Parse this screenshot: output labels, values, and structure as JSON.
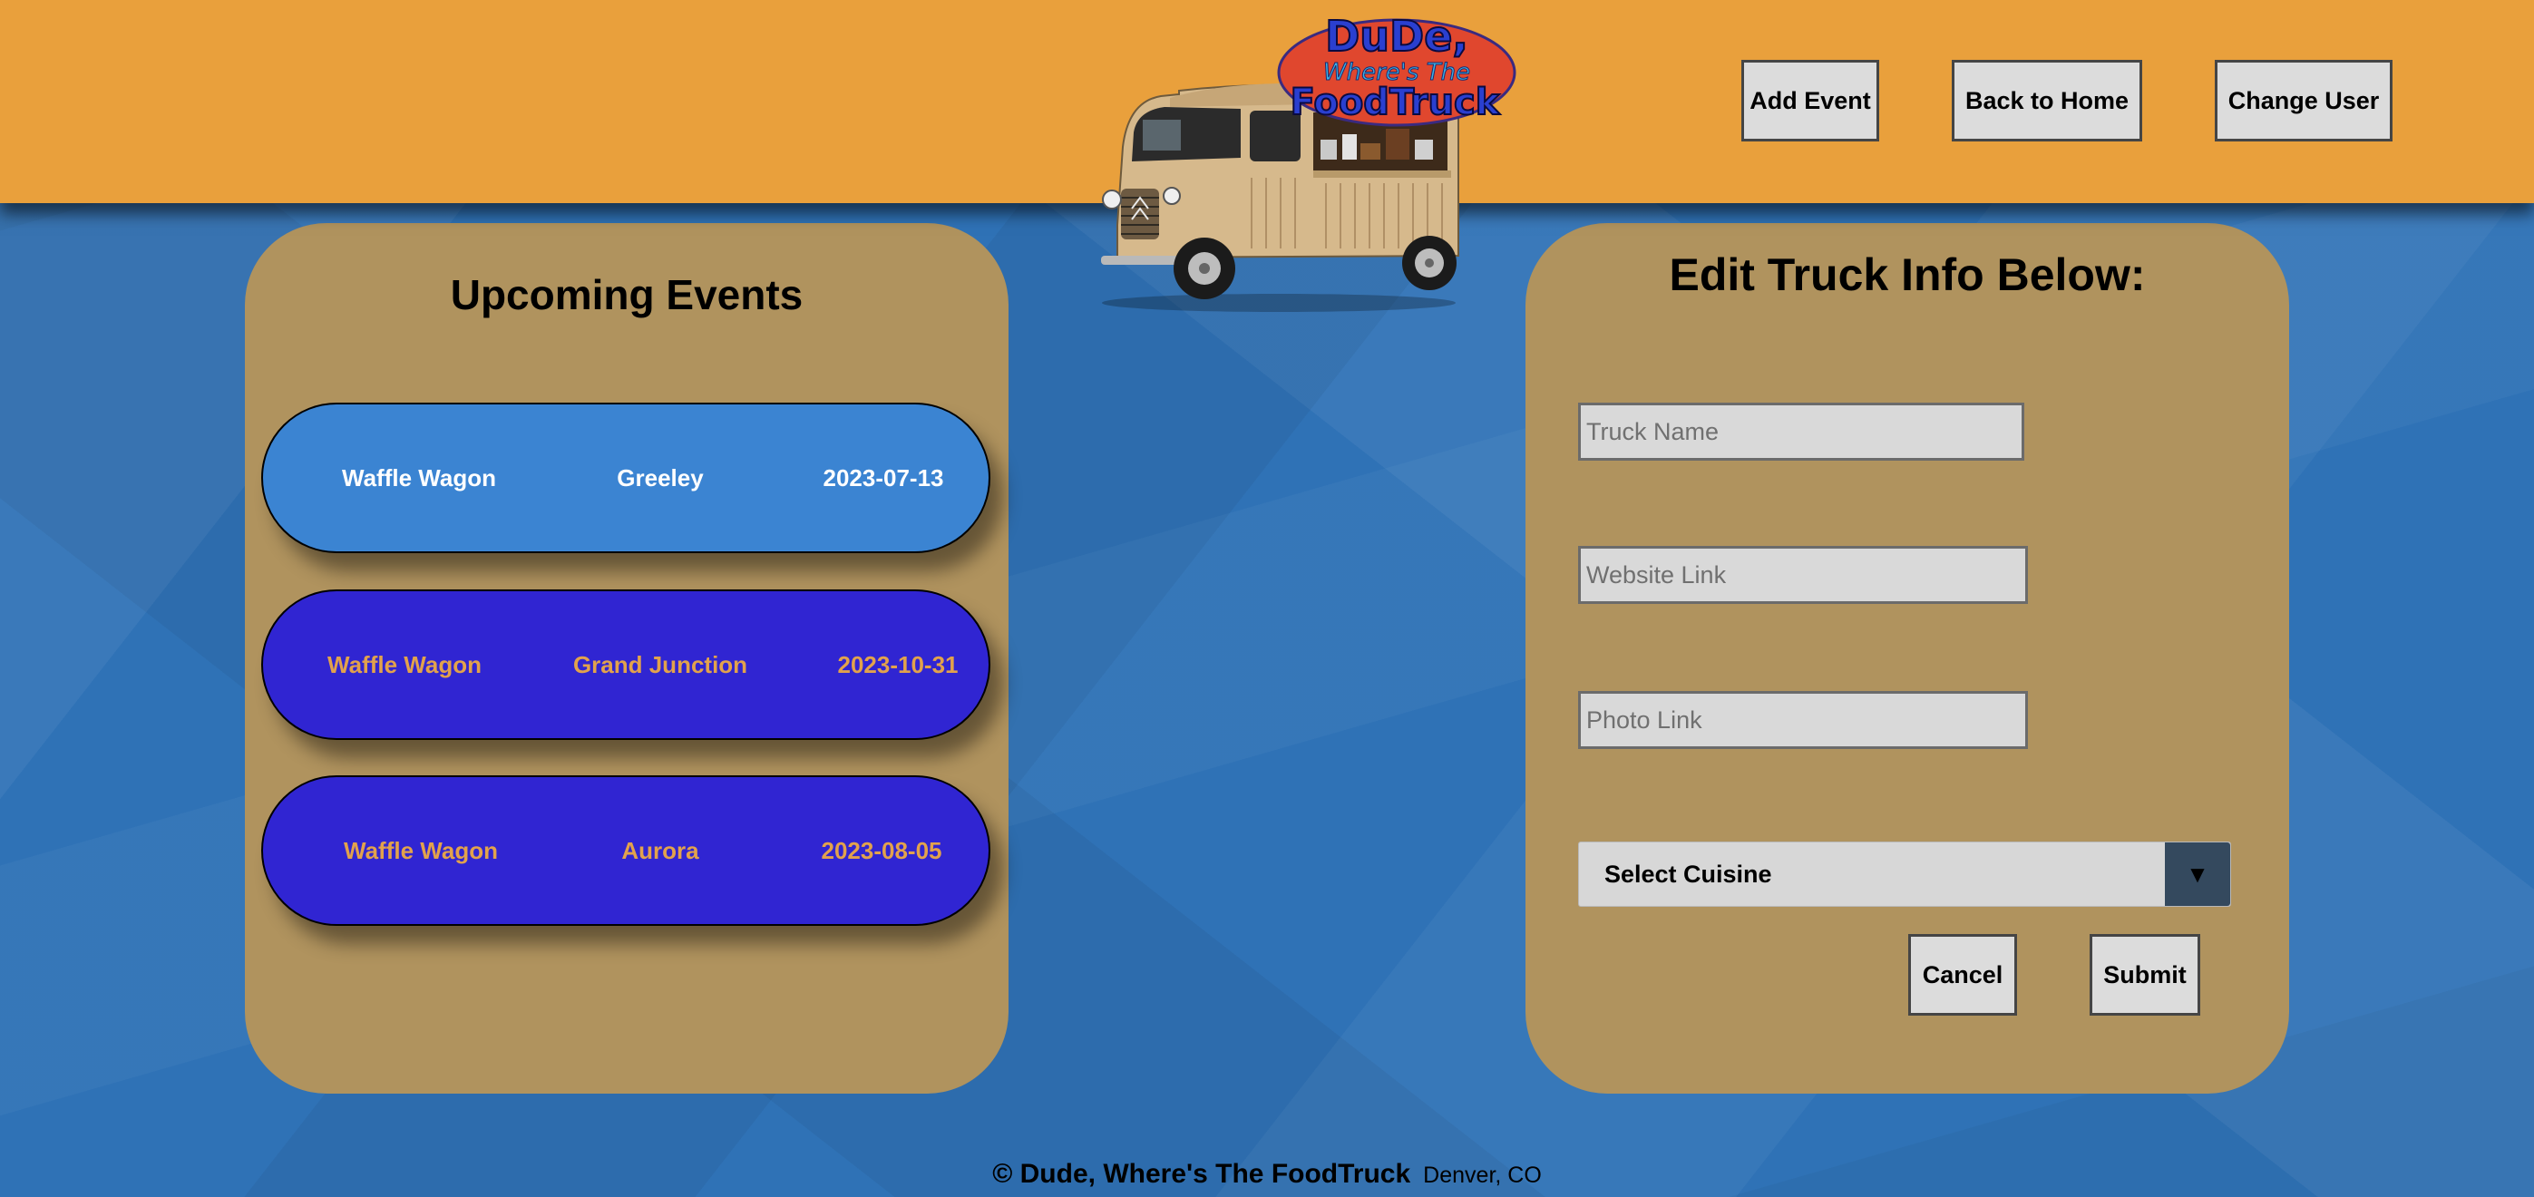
{
  "header": {
    "logo": {
      "line1": "DuDe,",
      "line2": "Where's The",
      "line3": "FoodTruck"
    },
    "buttons": {
      "add_event": "Add Event",
      "back_home": "Back to Home",
      "change_user": "Change User"
    }
  },
  "events": {
    "title": "Upcoming Events",
    "rows": [
      {
        "name": "Waffle Wagon",
        "city": "Greeley",
        "date": "2023-07-13",
        "selected": true
      },
      {
        "name": "Waffle Wagon",
        "city": "Grand Junction",
        "date": "2023-10-31",
        "selected": false
      },
      {
        "name": "Waffle Wagon",
        "city": "Aurora",
        "date": "2023-08-05",
        "selected": false
      }
    ]
  },
  "form": {
    "title": "Edit Truck Info Below:",
    "truck_name": {
      "value": "",
      "placeholder": "Truck Name"
    },
    "website_link": {
      "value": "",
      "placeholder": "Website Link"
    },
    "photo_link": {
      "value": "",
      "placeholder": "Photo Link"
    },
    "cuisine": {
      "selected": "Select Cuisine",
      "arrow": "▼"
    },
    "cancel_label": "Cancel",
    "submit_label": "Submit"
  },
  "footer": {
    "copyright": "© Dude, Where's The FoodTruck",
    "location": "Denver, CO"
  },
  "colors": {
    "header_bg": "#e9a03c",
    "page_bg": "#2f72b6",
    "panel_bg": "#b0935e",
    "event_selected_bg": "#3b84d2",
    "event_bg": "#3025d2",
    "event_text": "#e2a24c",
    "select_arrow_bg": "#34495e"
  },
  "icons": {
    "logo": "food-truck-logo",
    "select_arrow": "triangle-down-icon"
  }
}
